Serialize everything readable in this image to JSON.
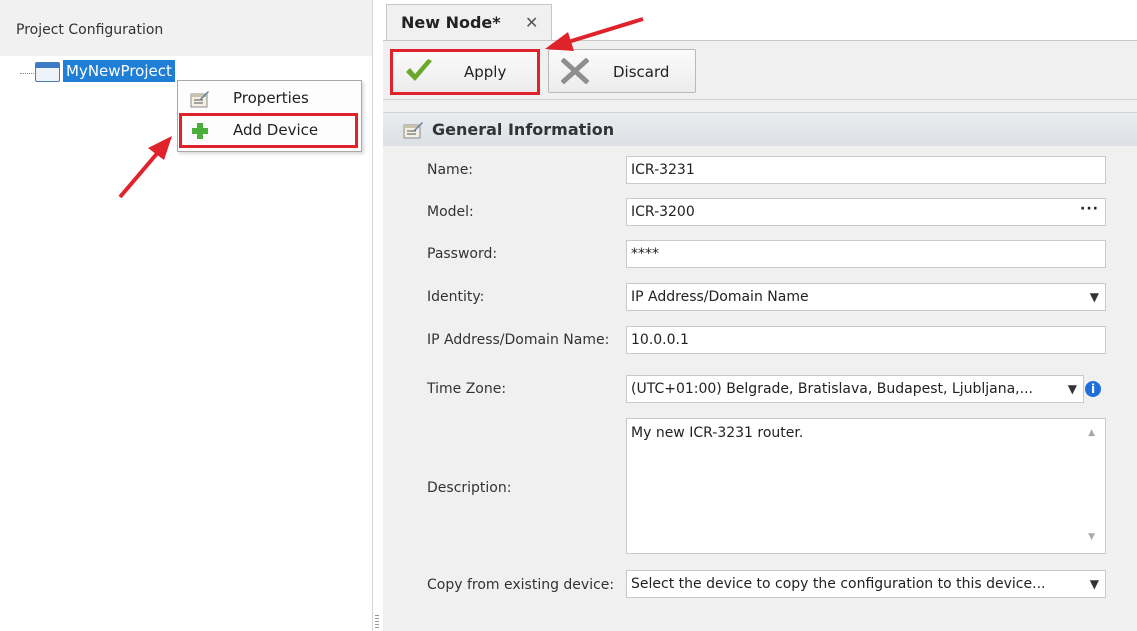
{
  "left_panel": {
    "title": "Project Configuration",
    "tree": {
      "root_label": "MyNewProject"
    },
    "context_menu": {
      "items": [
        "Properties",
        "Add Device"
      ]
    }
  },
  "tab": {
    "label": "New Node*",
    "close_glyph": "✕"
  },
  "toolbar": {
    "apply_label": "Apply",
    "discard_label": "Discard"
  },
  "group": {
    "title": "General Information"
  },
  "form": {
    "name_label": "Name:",
    "name_value": "ICR-3231",
    "model_label": "Model:",
    "model_value": "ICR-3200",
    "password_label": "Password:",
    "password_value": "****",
    "identity_label": "Identity:",
    "identity_value": "IP Address/Domain Name",
    "ip_label": "IP Address/Domain Name:",
    "ip_value": "10.0.0.1",
    "timezone_label": "Time Zone:",
    "timezone_value": "(UTC+01:00) Belgrade, Bratislava, Budapest, Ljubljana,...",
    "description_label": "Description:",
    "description_value": "My new ICR-3231 router.",
    "copy_label": "Copy from existing device:",
    "copy_value": "Select the device to copy the configuration to this device..."
  },
  "colors": {
    "highlight": "#e0232b",
    "selection": "#1f7fd6",
    "info": "#1e6fd9"
  }
}
